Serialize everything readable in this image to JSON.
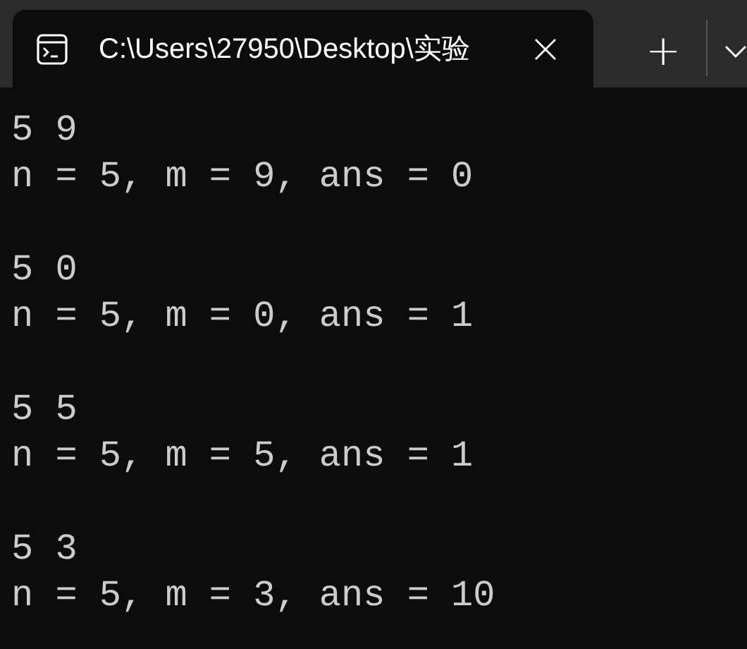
{
  "tabs": [
    {
      "title": "C:\\Users\\27950\\Desktop\\实验",
      "selected": true
    }
  ],
  "new_tab_button": "+",
  "terminal": {
    "runs": [
      {
        "input": "5 9",
        "output": "n = 5, m = 9, ans = 0"
      },
      {
        "input": "5 0",
        "output": "n = 5, m = 0, ans = 1"
      },
      {
        "input": "5 5",
        "output": "n = 5, m = 5, ans = 1"
      },
      {
        "input": "5 3",
        "output": "n = 5, m = 3, ans = 10"
      }
    ]
  }
}
